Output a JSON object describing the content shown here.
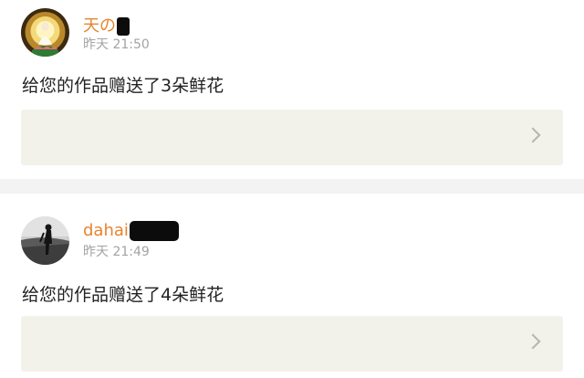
{
  "notifications": [
    {
      "username": "天の",
      "time": "昨天 21:50",
      "message": "给您的作品赠送了3朵鲜花",
      "avatar_icon": "bodhisattva-avatar-icon"
    },
    {
      "username": "dahai",
      "time": "昨天 21:49",
      "message": "给您的作品赠送了4朵鲜花",
      "avatar_icon": "person-photo-avatar-icon"
    }
  ],
  "colors": {
    "username": "#e7842f",
    "time": "#a3a3a3",
    "message": "#222222",
    "link_card_bg": "#f2f2ea",
    "separator": "#f3f3f3"
  }
}
